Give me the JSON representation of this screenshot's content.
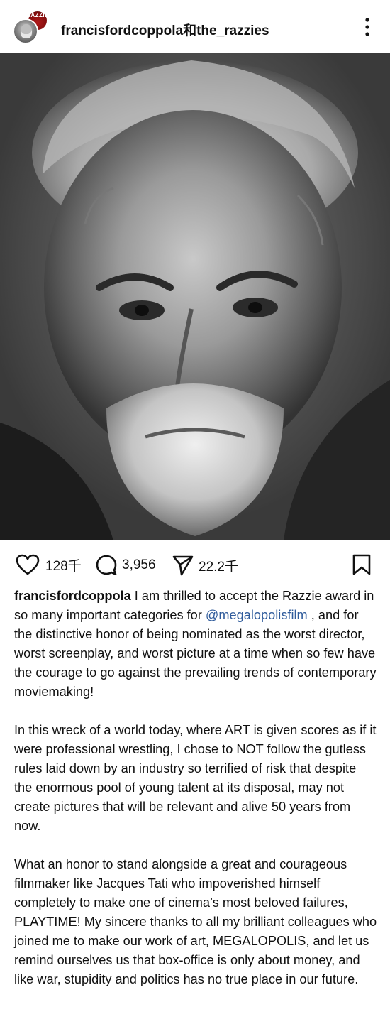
{
  "header": {
    "username": "francisfordcoppola和the_razzies",
    "badge_text": "RAZZIE"
  },
  "post": {
    "image_icon": "portrait-photo",
    "likes": "128千",
    "comments": "3,956",
    "shares": "22.2千"
  },
  "caption": {
    "author": "francisfordcoppola",
    "p1_before": " I am thrilled to accept the Razzie award in so many important categories for ",
    "mention": "@megalopolisfilm",
    "p1_after": " , and for the distinctive honor of being nominated as the worst director, worst screenplay, and worst picture at a time when so few have the courage to go against the prevailing trends of contemporary moviemaking!",
    "p2": "In this wreck of a world today, where ART is given scores as if it were professional wrestling, I chose to NOT follow the gutless rules laid down by an industry so terrified of risk that despite the enormous pool of young talent at its disposal, may not create pictures that will be relevant and alive 50 years from now.",
    "p3": "What an honor to stand alongside a great and courageous filmmaker like Jacques Tati who impoverished himself completely to make one of cinema’s most beloved failures, PLAYTIME! My sincere thanks to all my brilliant colleagues who joined me to make our work of art, MEGALOPOLIS, and let us remind ourselves us that box-office is only about money, and like war, stupidity and politics has no true place in our future."
  },
  "colors": {
    "mention": "#2f5b9b",
    "text": "#111111",
    "background": "#ffffff"
  }
}
